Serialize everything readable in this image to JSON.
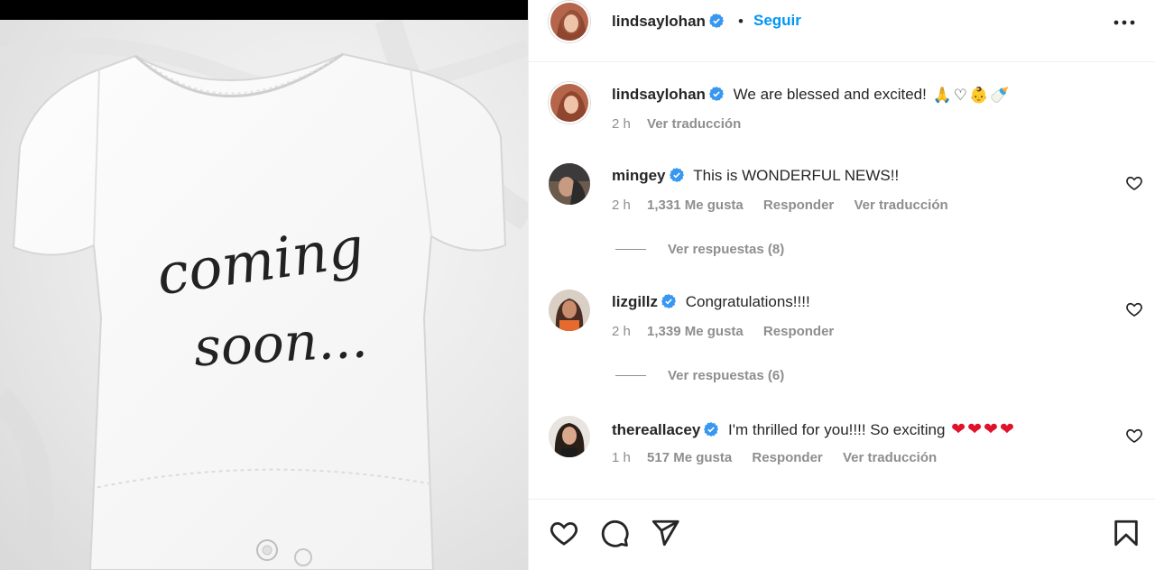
{
  "post": {
    "image_text_line1": "coming",
    "image_text_line2": "soon..."
  },
  "header": {
    "username": "lindsaylohan",
    "separator": "•",
    "follow_label": "Seguir",
    "more_icon": "more-horizontal-icon"
  },
  "caption": {
    "username": "lindsaylohan",
    "text": "We are blessed and excited!",
    "emojis": [
      "🙏",
      "♡",
      "👶",
      "🍼"
    ],
    "time": "2 h",
    "translate_label": "Ver traducción"
  },
  "comments": [
    {
      "username": "mingey",
      "text": "This is WONDERFUL NEWS!!",
      "time": "2 h",
      "likes": "1,331 Me gusta",
      "reply_label": "Responder",
      "translate_label": "Ver traducción",
      "view_replies": "Ver respuestas (8)"
    },
    {
      "username": "lizgillz",
      "text": "Congratulations!!!!",
      "time": "2 h",
      "likes": "1,339 Me gusta",
      "reply_label": "Responder",
      "view_replies": "Ver respuestas (6)"
    },
    {
      "username": "thereallacey",
      "text": "I'm thrilled for you!!!! So exciting",
      "hearts": [
        "❤",
        "❤",
        "❤",
        "❤"
      ],
      "time": "1 h",
      "likes": "517 Me gusta",
      "reply_label": "Responder",
      "translate_label": "Ver traducción"
    }
  ],
  "colors": {
    "accent": "#0095f6",
    "verified": "#3897f0",
    "muted": "#8e8e8e",
    "heart": "#e0112b"
  },
  "icons": {
    "like": "heart-outline-icon",
    "comment": "comment-bubble-icon",
    "share": "paper-plane-icon",
    "save": "bookmark-icon"
  }
}
